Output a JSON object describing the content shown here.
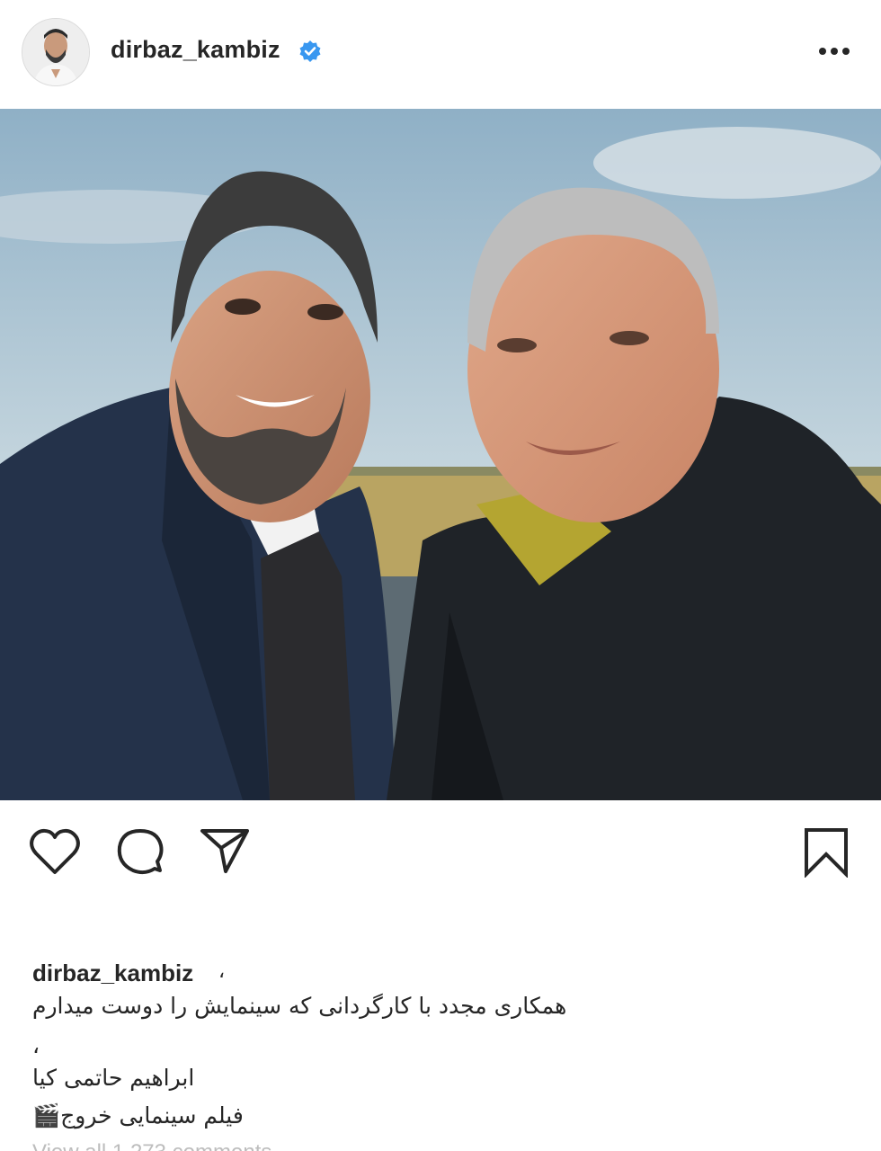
{
  "post": {
    "username": "dirbaz_kambiz",
    "verified_icon": "verified-badge-icon",
    "more_icon": "more-options-icon"
  },
  "colors": {
    "text": "#262626",
    "verified_blue": "#3897f0",
    "sky_top": "#8fb0c6",
    "sky_bottom": "#dfe7ea",
    "field": "#b9a462",
    "jacket_left": "#24324a",
    "jacket_right": "#1f2328"
  },
  "actions": {
    "like_icon": "heart-icon",
    "comment_icon": "comment-bubble-icon",
    "share_icon": "paper-plane-icon",
    "save_icon": "bookmark-icon"
  },
  "caption": {
    "username": "dirbaz_kambiz",
    "comma": "،",
    "line1": "همکاری مجدد با کارگردانی که سینمایش را دوست میدارم",
    "line2": "،",
    "line3": "ابراهیم حاتمی کیا",
    "line4": "فیلم سینمایی خروج🎬",
    "partial_line": "View all 1,273 comments"
  }
}
